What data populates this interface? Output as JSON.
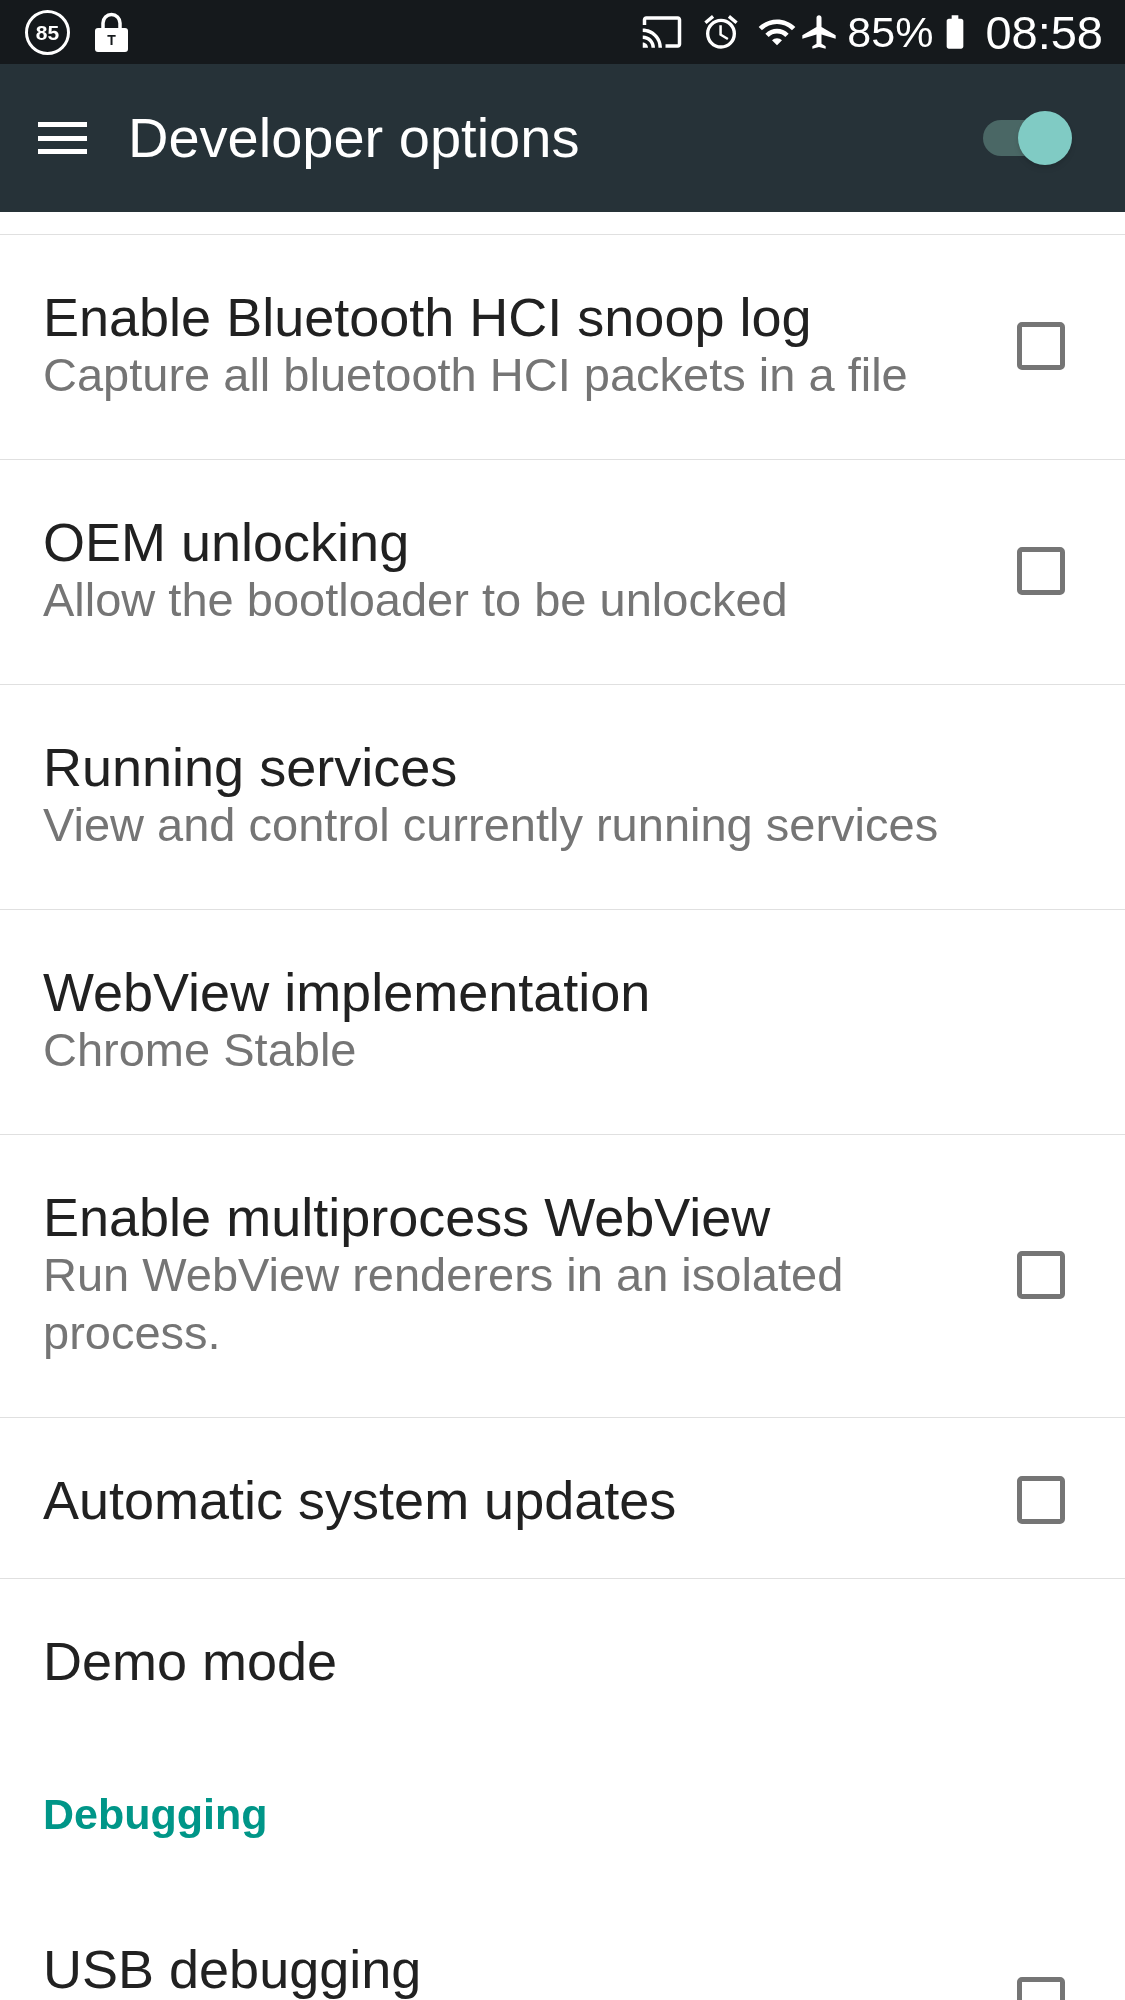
{
  "status_bar": {
    "notification_count": "85",
    "lock_badge": "T",
    "battery": "85%",
    "time": "08:58"
  },
  "toolbar": {
    "title": "Developer options",
    "master_switch": {
      "on": true
    }
  },
  "sections": [
    {
      "items": [
        {
          "kind": "checkbox",
          "title": "Enable Bluetooth HCI snoop log",
          "summary": "Capture all bluetooth HCI packets in a file",
          "checked": false
        },
        {
          "kind": "checkbox",
          "title": "OEM unlocking",
          "summary": "Allow the bootloader to be unlocked",
          "checked": false
        },
        {
          "kind": "plain",
          "title": "Running services",
          "summary": "View and control currently running services"
        },
        {
          "kind": "plain",
          "title": "WebView implementation",
          "summary": "Chrome Stable"
        },
        {
          "kind": "checkbox",
          "title": "Enable multiprocess WebView",
          "summary": "Run WebView renderers in an isolated process.",
          "checked": false
        },
        {
          "kind": "checkbox",
          "title": "Automatic system updates",
          "checked": false
        },
        {
          "kind": "plain",
          "title": "Demo mode"
        }
      ]
    },
    {
      "title": "Debugging",
      "items": [
        {
          "kind": "checkbox",
          "title": "USB debugging",
          "checked": false
        }
      ]
    }
  ]
}
